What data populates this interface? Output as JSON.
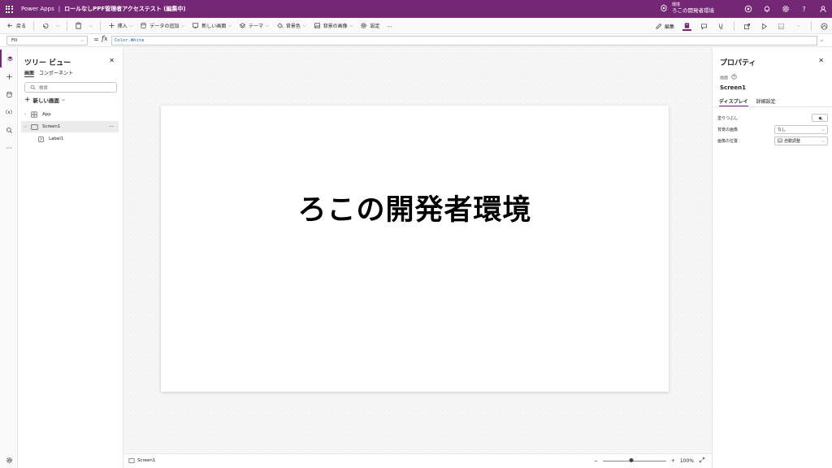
{
  "titlebar": {
    "app_name": "Power Apps",
    "separator": "|",
    "app_title": "ロールなしPPF管理者アクセステスト (編集中)",
    "env_label": "環境",
    "env_name": "ろこの開発者環境"
  },
  "command_bar": {
    "back": "戻る",
    "insert": "挿入",
    "add_data": "データの追加",
    "new_screen": "新しい画面",
    "theme": "テーマ",
    "background_color": "背景色",
    "background_image": "背景の画像",
    "settings": "設定",
    "more": "...",
    "edit": "編集"
  },
  "formula_bar": {
    "property": "Fill",
    "equals": "=",
    "fx": "fx",
    "formula": "Color.White"
  },
  "tree_view": {
    "title": "ツリー ビュー",
    "tabs": [
      "画面",
      "コンポーネント"
    ],
    "search_placeholder": "検索",
    "new_screen": "新しい画面",
    "items": [
      {
        "label": "App"
      },
      {
        "label": "Screen1"
      },
      {
        "label": "Label1"
      }
    ],
    "more": "···"
  },
  "canvas": {
    "label_text": "ろこの開発者環境"
  },
  "status_bar": {
    "screen_name": "Screen1",
    "zoom_minus": "−",
    "zoom_plus": "+",
    "zoom_level": "100%",
    "zoom_fraction": 0.45
  },
  "properties": {
    "title": "プロパティ",
    "type_label": "画面",
    "control_name": "Screen1",
    "tabs": [
      "ディスプレイ",
      "詳細設定"
    ],
    "rows": [
      {
        "label": "塗りつぶし"
      },
      {
        "label": "背景の画像",
        "value": "なし"
      },
      {
        "label": "画像の位置",
        "value": "自動調整"
      }
    ]
  },
  "colors": {
    "brand": "#742774",
    "canvas_bg": "#f6f6f6"
  }
}
